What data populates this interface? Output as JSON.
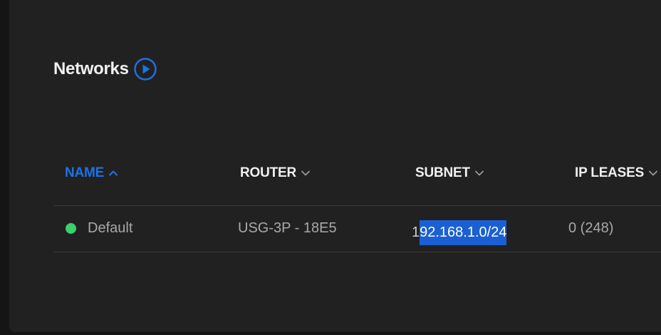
{
  "page": {
    "title": "Networks"
  },
  "icons": {
    "title_action": "play-circle-icon",
    "sort_asc": "chevron-up-icon",
    "sort_desc": "chevron-down-icon",
    "status": "status-dot"
  },
  "colors": {
    "accent": "#1a73e8",
    "status_online": "#3ad16a",
    "selection": "#1a5fd6"
  },
  "table": {
    "columns": [
      {
        "label": "NAME",
        "active": true,
        "sort": "asc"
      },
      {
        "label": "ROUTER",
        "active": false,
        "sort": "desc"
      },
      {
        "label": "SUBNET",
        "active": false,
        "sort": "desc"
      },
      {
        "label": "IP LEASES",
        "active": false,
        "sort": "desc"
      }
    ],
    "rows": [
      {
        "name": "Default",
        "status": "online",
        "router": "USG-3P - 18E5",
        "subnet_unselected": "1",
        "subnet_selected": "92.168.1.0/24",
        "ip_leases": "0 (248)"
      }
    ]
  }
}
